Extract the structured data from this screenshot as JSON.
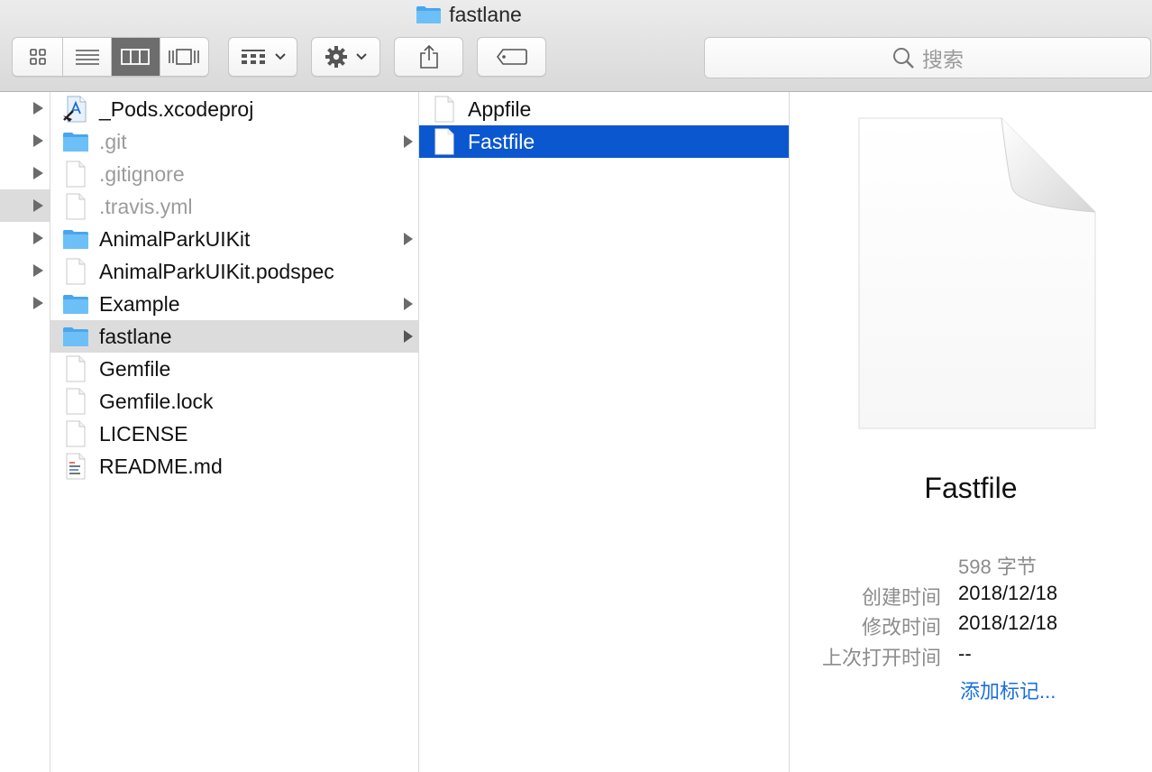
{
  "window": {
    "title": "fastlane"
  },
  "toolbar": {
    "view_modes": [
      "icon-view",
      "list-view",
      "column-view",
      "gallery-view"
    ],
    "active_view": "column-view",
    "group_by_icon": "grid-icon",
    "action_icon": "gear-icon",
    "share_icon": "share-icon",
    "tag_icon": "tag-icon",
    "search_placeholder": "搜索"
  },
  "column1": {
    "items": [
      {
        "name": "_Pods.xcodeproj",
        "kind": "xcodeproj",
        "dim": false,
        "folder": false
      },
      {
        "name": ".git",
        "kind": "folder",
        "dim": true,
        "folder": true
      },
      {
        "name": ".gitignore",
        "kind": "file",
        "dim": true,
        "folder": false
      },
      {
        "name": ".travis.yml",
        "kind": "file",
        "dim": true,
        "folder": false
      },
      {
        "name": "AnimalParkUIKit",
        "kind": "folder",
        "dim": false,
        "folder": true
      },
      {
        "name": "AnimalParkUIKit.podspec",
        "kind": "file",
        "dim": false,
        "folder": false
      },
      {
        "name": "Example",
        "kind": "folder",
        "dim": false,
        "folder": true
      },
      {
        "name": "fastlane",
        "kind": "folder",
        "dim": false,
        "folder": true,
        "selected": true
      },
      {
        "name": "Gemfile",
        "kind": "file",
        "dim": false,
        "folder": false
      },
      {
        "name": "Gemfile.lock",
        "kind": "file",
        "dim": false,
        "folder": false
      },
      {
        "name": "LICENSE",
        "kind": "file",
        "dim": false,
        "folder": false
      },
      {
        "name": "README.md",
        "kind": "markdown",
        "dim": false,
        "folder": false
      }
    ]
  },
  "column2": {
    "items": [
      {
        "name": "Appfile",
        "selected": false
      },
      {
        "name": "Fastfile",
        "selected": true
      }
    ]
  },
  "preview": {
    "file_name": "Fastfile",
    "size": "598 字节",
    "created_label": "创建时间",
    "created_value": "2018/12/18",
    "modified_label": "修改时间",
    "modified_value": "2018/12/18",
    "opened_label": "上次打开时间",
    "opened_value": "--",
    "add_tags": "添加标记..."
  },
  "colors": {
    "selection_blue": "#0b57d0",
    "folder_blue": "#63b9f5",
    "link_blue": "#1a6fe0"
  }
}
